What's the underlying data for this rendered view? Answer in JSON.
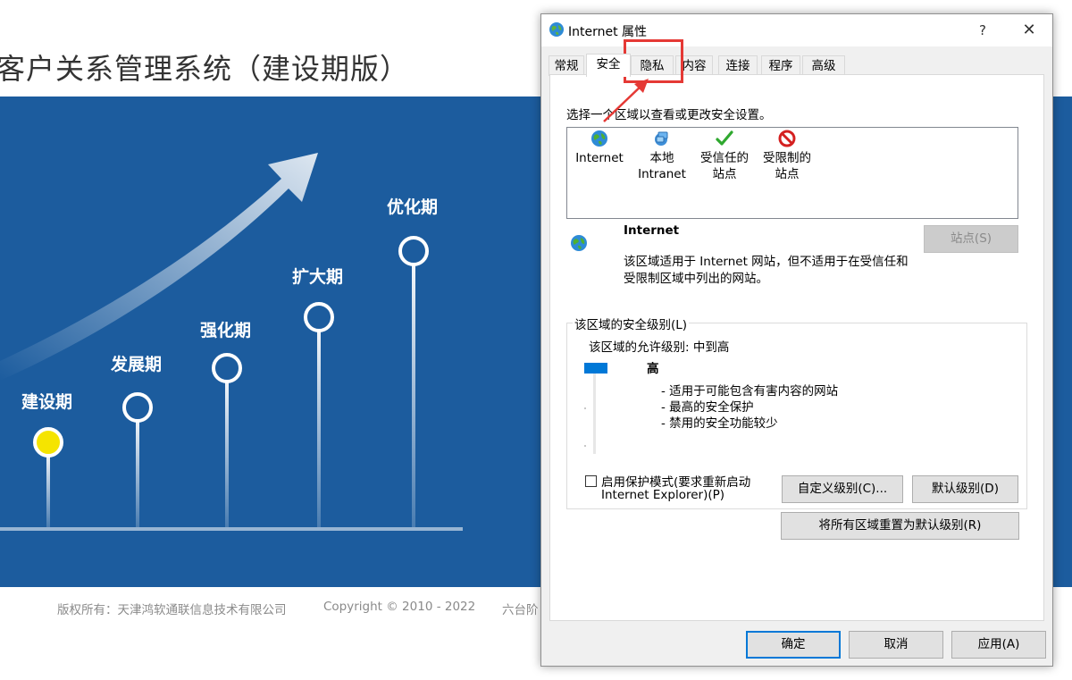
{
  "background_page": {
    "title": "客户关系管理系统（建设期版）",
    "stages": [
      "建设期",
      "发展期",
      "强化期",
      "扩大期",
      "优化期"
    ],
    "footer": {
      "copyright_owner": "版权所有：天津鸿软通联信息技术有限公司",
      "copyright": "Copyright © 2010 - 2022",
      "partial_text": "六台阶"
    },
    "colors": {
      "hero_bg": "#1c5c9e",
      "active_stage": "#f5e400"
    }
  },
  "dialog": {
    "title": "Internet 属性",
    "help_symbol": "?",
    "close_symbol": "✕",
    "tabs": [
      "常规",
      "安全",
      "隐私",
      "内容",
      "连接",
      "程序",
      "高级"
    ],
    "active_tab": "安全",
    "security": {
      "instruction": "选择一个区域以查看或更改安全设置。",
      "zones": [
        {
          "label": "Internet",
          "icon": "globe-icon"
        },
        {
          "label": "本地\nIntranet",
          "icon": "intranet-icon"
        },
        {
          "label": "受信任的\n站点",
          "icon": "checkmark-icon"
        },
        {
          "label": "受限制的\n站点",
          "icon": "restricted-icon"
        }
      ],
      "selected_zone": {
        "name": "Internet",
        "description_line1": "该区域适用于 Internet 网站，但不适用于在受信任和",
        "description_line2": "受限制区域中列出的网站。"
      },
      "sites_button": "站点(S)",
      "level_group_title": "该区域的安全级别(L)",
      "allowed_levels": "该区域的允许级别: 中到高",
      "level_name": "高",
      "level_bullets": [
        "- 适用于可能包含有害内容的网站",
        "- 最高的安全保护",
        "- 禁用的安全功能较少"
      ],
      "protected_mode_line1": "启用保护模式(要求重新启动",
      "protected_mode_line2": "Internet Explorer)(P)",
      "protected_mode_checked": false,
      "custom_level_button": "自定义级别(C)...",
      "default_level_button": "默认级别(D)",
      "reset_all_button": "将所有区域重置为默认级别(R)"
    },
    "footer_buttons": {
      "ok": "确定",
      "cancel": "取消",
      "apply": "应用(A)"
    },
    "accent_color": "#0078d7",
    "highlight_color": "#e53935"
  }
}
